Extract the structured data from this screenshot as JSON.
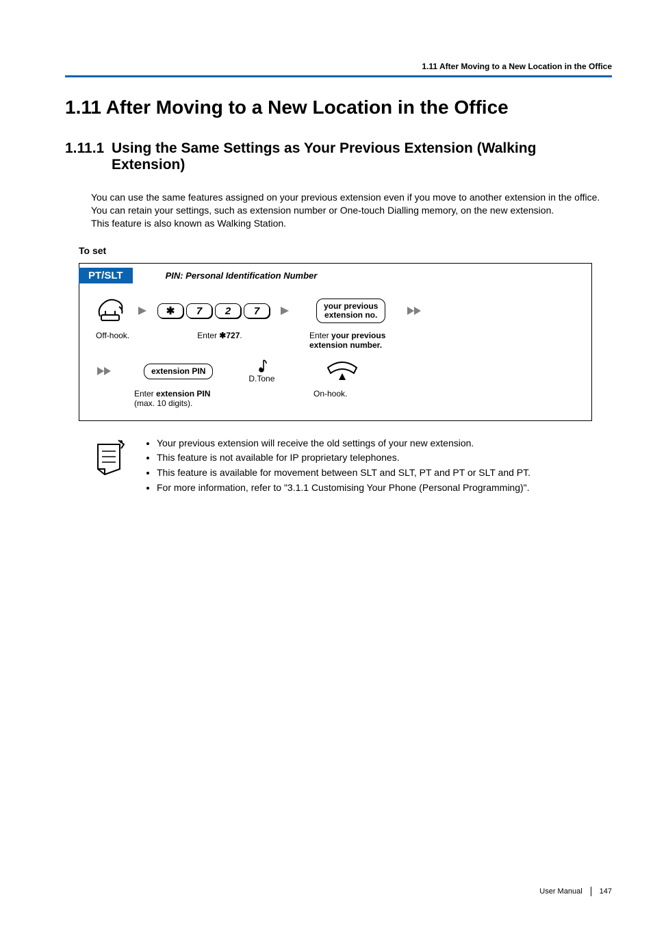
{
  "header": {
    "running": "1.11 After Moving to a New Location in the Office"
  },
  "section": {
    "title": "1.11   After Moving to a New Location in the Office"
  },
  "subsection": {
    "number": "1.11.1",
    "title": "Using the Same Settings as Your Previous Extension (Walking Extension)"
  },
  "intro": {
    "p1": "You can use the same features assigned on your previous extension even if you move to another extension in the office.",
    "p2": "You can retain your settings, such as extension number or One-touch Dialling memory, on the new extension.",
    "p3": "This feature is also known as Walking Station."
  },
  "to_set_label": "To set",
  "diagram": {
    "badge": "PT/SLT",
    "pin_label": "PIN: Personal Identification Number",
    "keys": {
      "star": "✱",
      "k7a": "7",
      "k2": "2",
      "k7b": "7"
    },
    "prev_ext_box_line1": "your previous",
    "prev_ext_box_line2": "extension no.",
    "offhook_label": "Off-hook.",
    "enter727_prefix": "Enter ",
    "enter727_code": "✱727",
    "enter727_suffix": ".",
    "enter_prev_line1_a": "Enter ",
    "enter_prev_line1_b": "your previous",
    "enter_prev_line2": "extension number.",
    "ext_pin_box": "extension PIN",
    "dtone_label": "D.Tone",
    "enter_pin_line1_a": "Enter ",
    "enter_pin_line1_b": "extension PIN",
    "enter_pin_line2": "(max. 10 digits).",
    "onhook_label": "On-hook."
  },
  "notes": {
    "n1": "Your previous extension will receive the old settings of your new extension.",
    "n2": "This feature is not available for IP proprietary telephones.",
    "n3": "This feature is available for movement between SLT and SLT, PT and PT or SLT and PT.",
    "n4": "For more information, refer to \"3.1.1 Customising Your Phone (Personal Programming)\"."
  },
  "footer": {
    "manual": "User Manual",
    "page": "147"
  }
}
